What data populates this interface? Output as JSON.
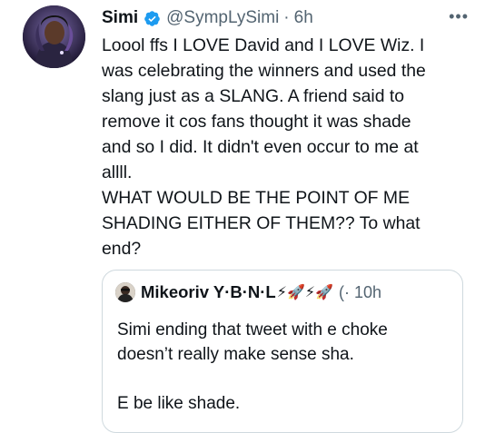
{
  "author": {
    "name": "Simi",
    "handle": "@SympLySimi",
    "separator": "·",
    "time": "6h"
  },
  "more_label": "•••",
  "tweet": {
    "text": "Loool ffs I LOVE David and I LOVE Wiz. I\nwas celebrating the winners and used the\nslang just as a SLANG. A friend said to\nremove it cos fans thought it was shade\nand so I did. It didn't even occur to me at\nallll.\nWHAT WOULD BE THE POINT OF ME\nSHADING EITHER OF THEM?? To what\nend?"
  },
  "quote": {
    "name": "Mikeoriv Y·B·N·L",
    "emojis": "⚡🚀⚡🚀",
    "time": "(· 10h",
    "text": "Simi ending that tweet with e choke\ndoesn’t really make sense sha.\n\nE be like shade."
  },
  "colors": {
    "verified": "#1d9bf0",
    "secondary_text": "#536471",
    "border": "#cfd9de"
  },
  "icons": {
    "verified": "verified-badge-icon",
    "more": "more-horizontal-icon"
  }
}
